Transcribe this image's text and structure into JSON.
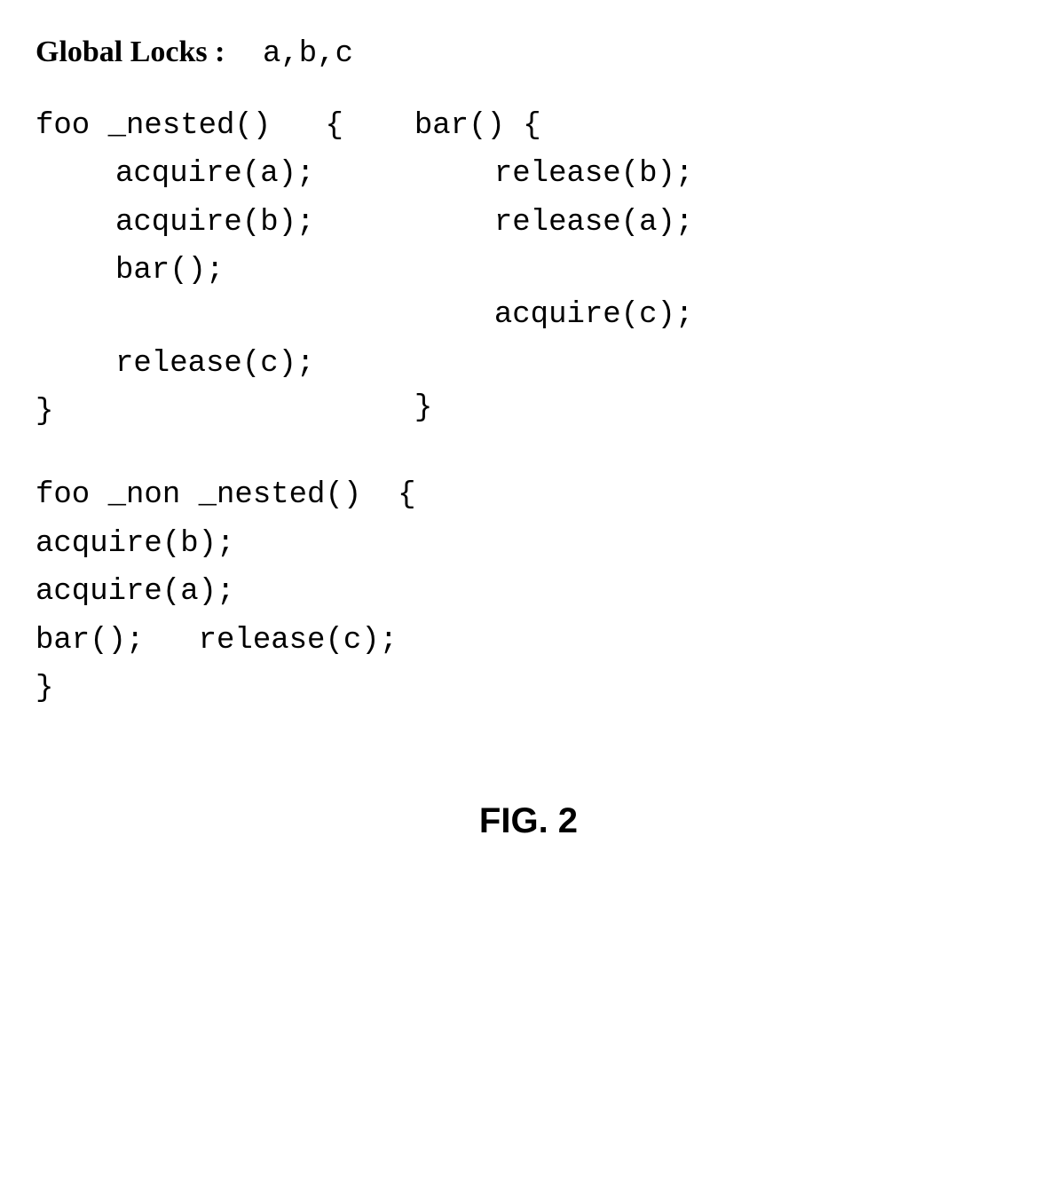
{
  "header": {
    "label": "Global Locks :",
    "value": "a,b,c"
  },
  "foo_nested": {
    "sig": "foo _nested()   {",
    "l1": "acquire(a);",
    "l2": "acquire(b);",
    "l3": "bar();",
    "l4": "release(c);",
    "close": "}"
  },
  "bar": {
    "sig": "bar() {",
    "l1": "release(b);",
    "l2": "release(a);",
    "l3": "acquire(c);",
    "close": "}"
  },
  "foo_non_nested": {
    "sig": "foo _non _nested()  {",
    "l1": "acquire(b);",
    "l2": "acquire(a);",
    "l3": "bar();   release(c);",
    "close": "}"
  },
  "figure": "FIG. 2"
}
